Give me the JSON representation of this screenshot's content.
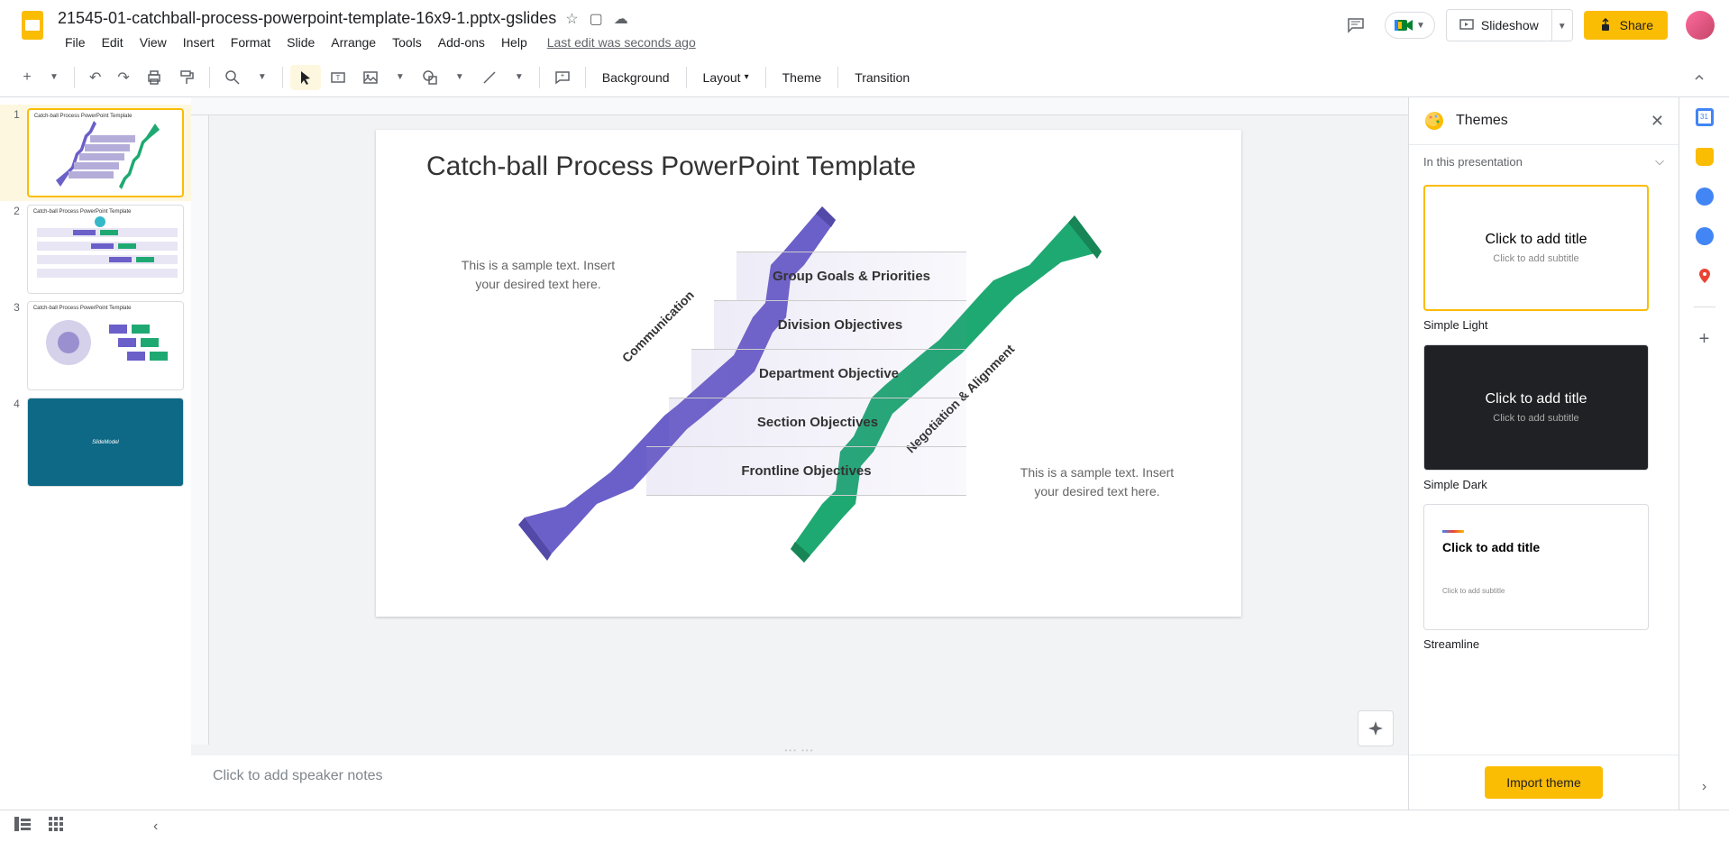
{
  "doc": {
    "title": "21545-01-catchball-process-powerpoint-template-16x9-1.pptx-gslides",
    "last_edit": "Last edit was seconds ago"
  },
  "menu": {
    "file": "File",
    "edit": "Edit",
    "view": "View",
    "insert": "Insert",
    "format": "Format",
    "slide": "Slide",
    "arrange": "Arrange",
    "tools": "Tools",
    "addons": "Add-ons",
    "help": "Help"
  },
  "header_buttons": {
    "slideshow": "Slideshow",
    "share": "Share"
  },
  "toolbar": {
    "background": "Background",
    "layout": "Layout",
    "theme": "Theme",
    "transition": "Transition"
  },
  "slides": {
    "s1": "1",
    "s2": "2",
    "s3": "3",
    "s4": "4",
    "thumb_title": "Catch-ball Process PowerPoint Template",
    "thumb4_logo": "SlideModel"
  },
  "slide_content": {
    "title": "Catch-ball Process PowerPoint Template",
    "sample_text": "This is a sample text. Insert your desired text here.",
    "communication": "Communication",
    "negotiation": "Negotiation & Alignment",
    "row1": "Group Goals & Priorities",
    "row2": "Division Objectives",
    "row3": "Department Objective",
    "row4": "Section Objectives",
    "row5": "Frontline Objectives"
  },
  "notes": {
    "placeholder": "Click to add speaker notes"
  },
  "themes": {
    "title": "Themes",
    "section": "In this presentation",
    "card_title": "Click to add title",
    "card_sub": "Click to add subtitle",
    "simple_light": "Simple Light",
    "simple_dark": "Simple Dark",
    "streamline": "Streamline",
    "import": "Import theme"
  }
}
